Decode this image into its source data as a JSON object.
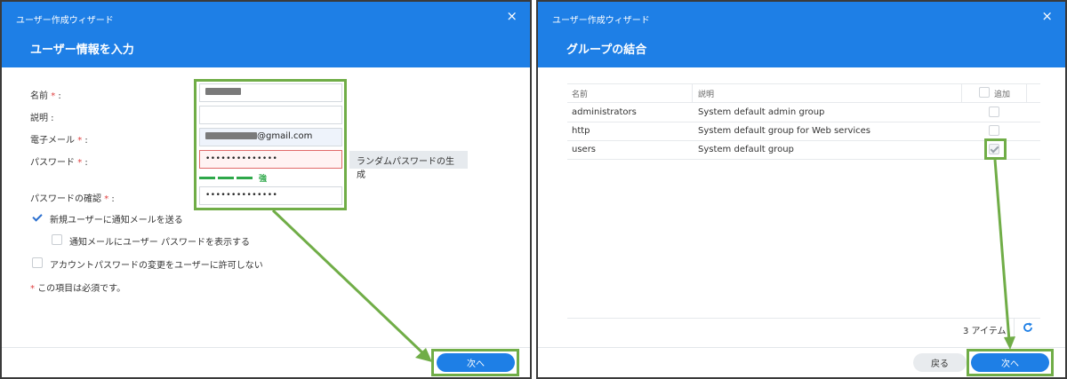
{
  "left": {
    "window_title": "ユーザー作成ウィザード",
    "close_glyph": "×",
    "step_title": "ユーザー情報を入力",
    "required_mark": "*",
    "fields": {
      "name_label": "名前",
      "desc_label": "説明 :",
      "email_label": "電子メール",
      "email_suffix": "@gmail.com",
      "password_label": "パスワード",
      "password_value": "••••••••••••••",
      "confirm_label": "パスワードの確認",
      "confirm_value": "••••••••••••••",
      "label_colon": " :"
    },
    "generate_button": "ランダムパスワードの生成",
    "strength_label": "強",
    "checkboxes": [
      {
        "label": "新規ユーザーに通知メールを送る",
        "checked": true
      },
      {
        "label": "通知メールにユーザー パスワードを表示する",
        "checked": false
      },
      {
        "label": "アカウントパスワードの変更をユーザーに許可しない",
        "checked": false
      }
    ],
    "required_note": "この項目は必須です。",
    "next_button": "次へ"
  },
  "right": {
    "window_title": "ユーザー作成ウィザード",
    "close_glyph": "×",
    "step_title": "グループの結合",
    "columns": {
      "name": "名前",
      "desc": "説明",
      "add": "追加"
    },
    "rows": [
      {
        "name": "administrators",
        "desc": "System default admin group",
        "added": false
      },
      {
        "name": "http",
        "desc": "System default group for Web services",
        "added": false
      },
      {
        "name": "users",
        "desc": "System default group",
        "added": true
      }
    ],
    "item_count": "3 アイテム",
    "back_button": "戻る",
    "next_button": "次へ"
  },
  "colors": {
    "header_blue": "#1e7fe6",
    "highlight_green": "#70ad47",
    "strength_green": "#2ea84a",
    "required_red": "#e04040"
  },
  "icons": [
    "close-icon",
    "check-icon",
    "refresh-icon",
    "arrow-icon"
  ]
}
